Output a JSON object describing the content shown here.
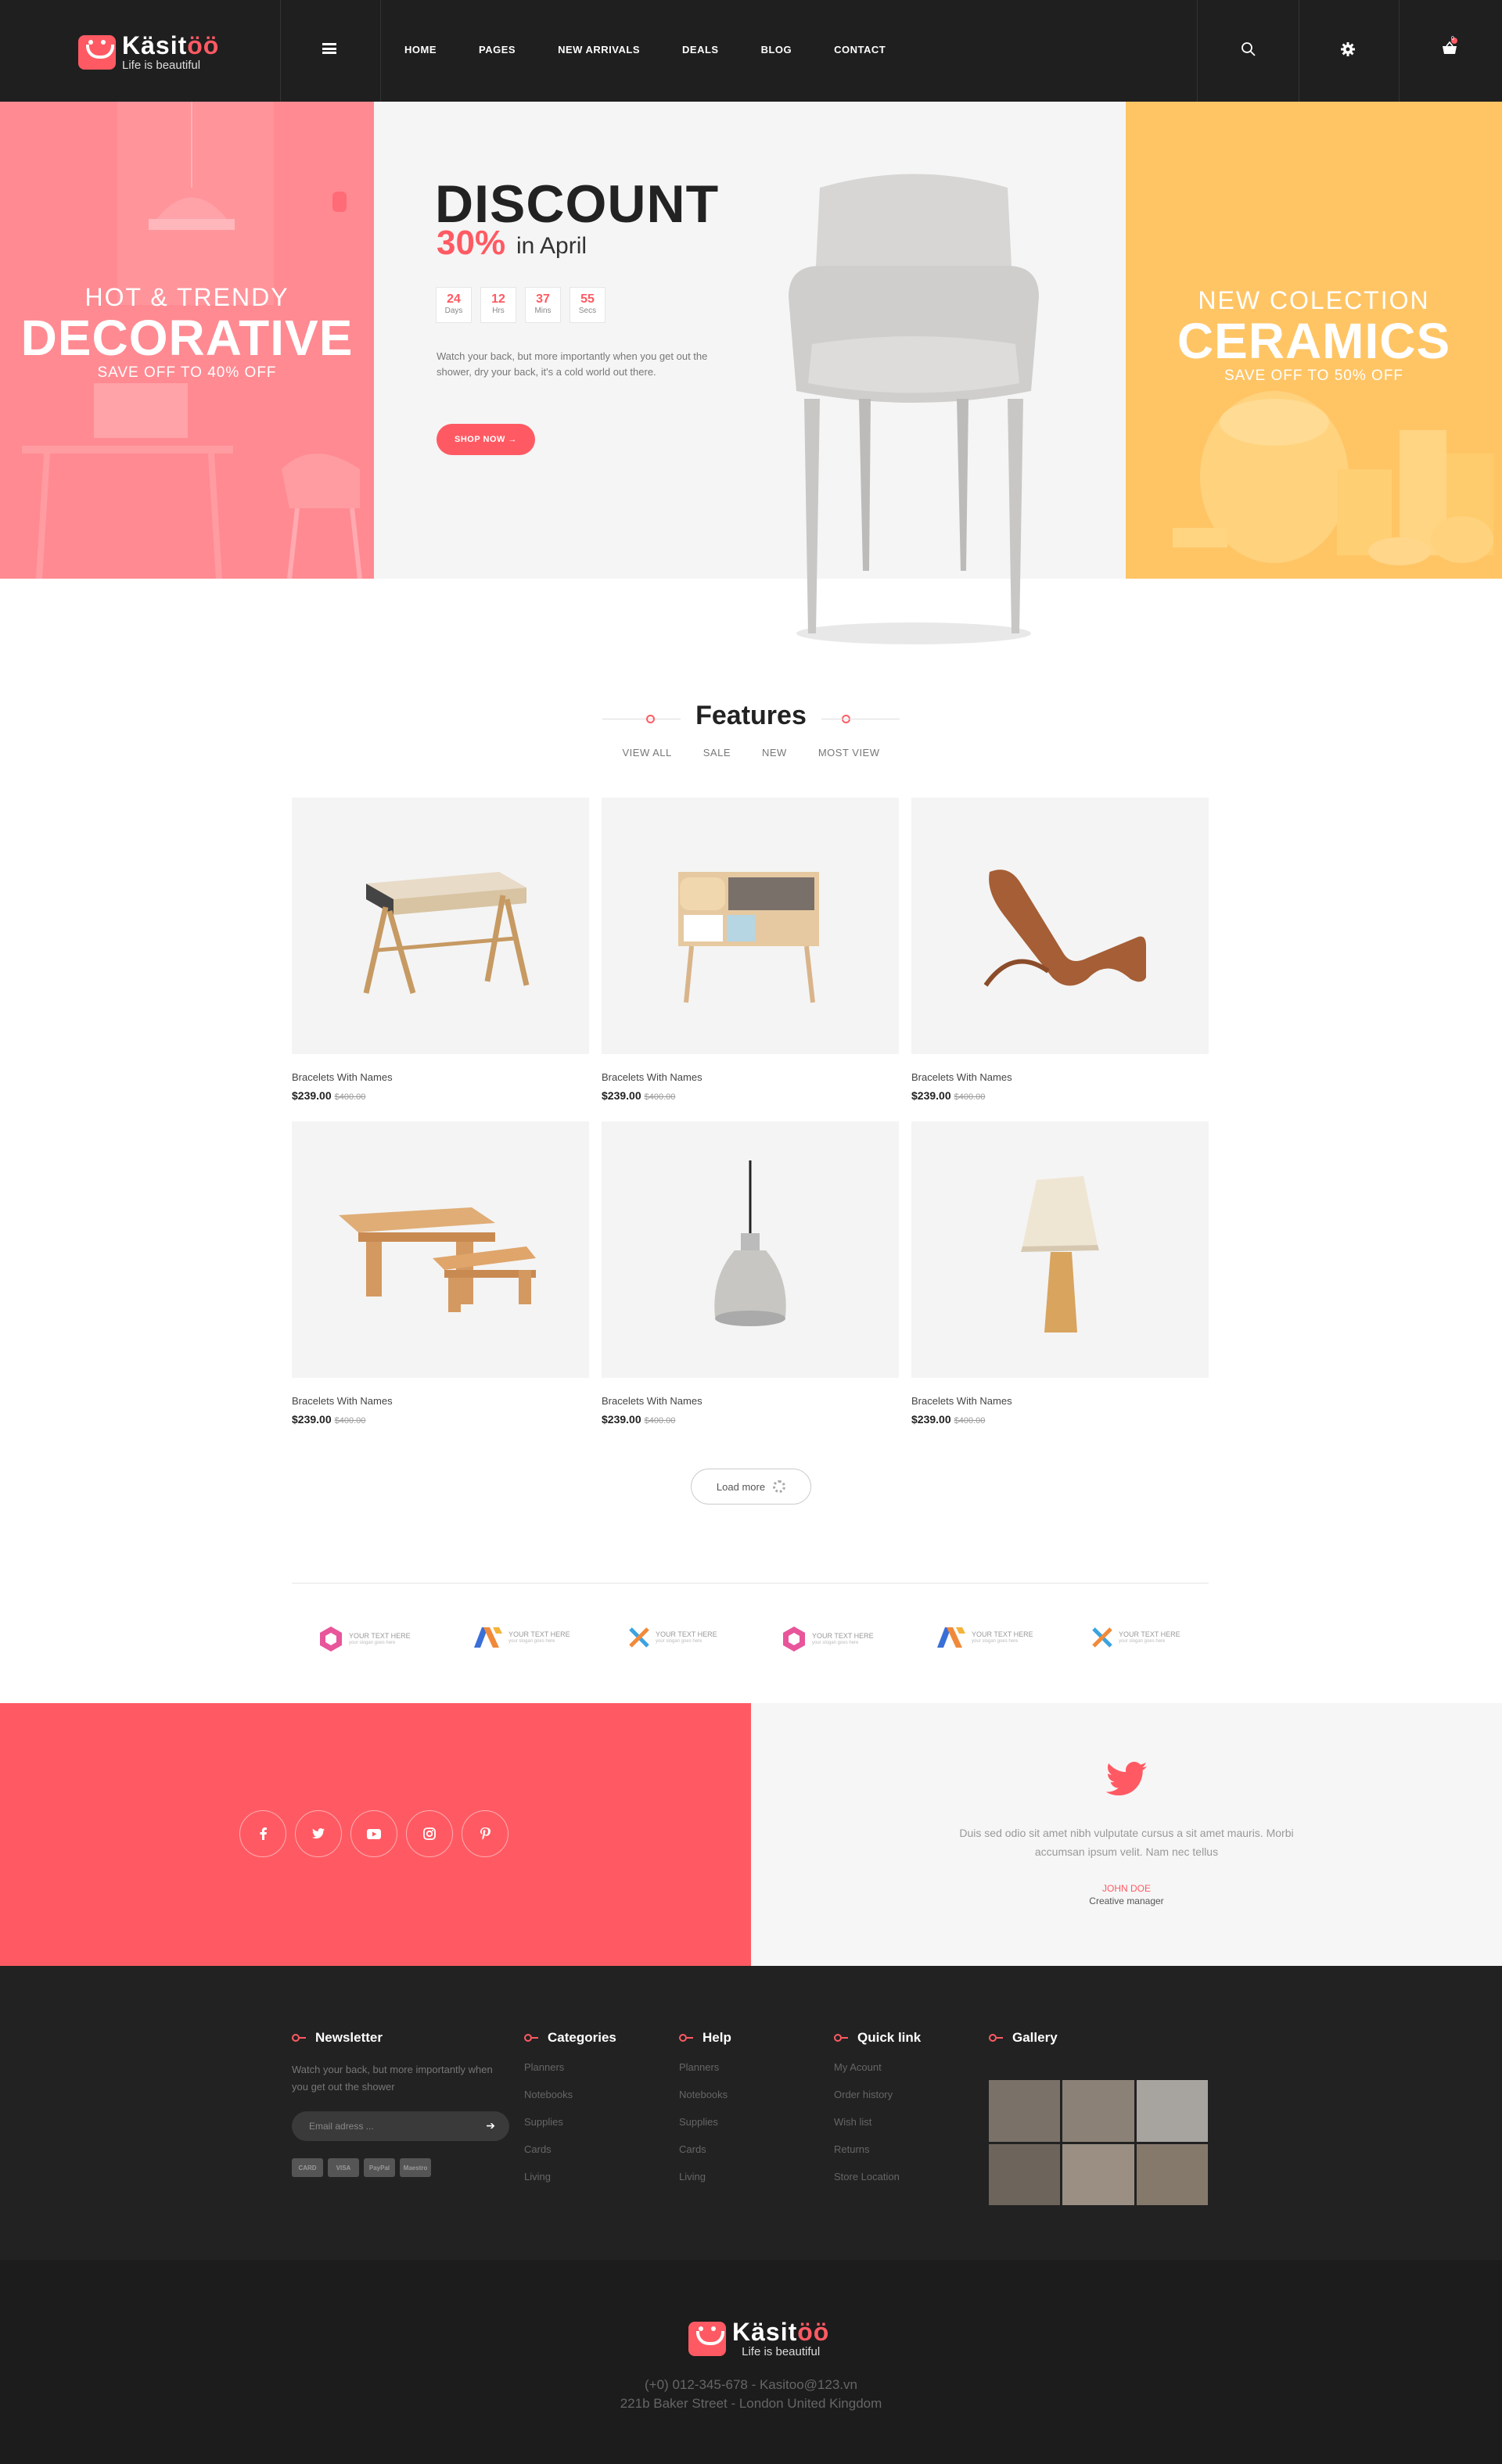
{
  "header": {
    "brand_name": "Kasitoo",
    "brand_name_display": "Käsitöö",
    "tagline": "Life is beautiful",
    "nav": [
      "HOME",
      "PAGES",
      "NEW ARRIVALS",
      "DEALS",
      "BLOG",
      "CONTACT"
    ],
    "cart_count": "0"
  },
  "hero": {
    "left": {
      "line1": "HOT & TRENDY",
      "line2": "DECORATIVE",
      "line3": "SAVE OFF TO 40% OFF"
    },
    "center": {
      "title": "DISCOUNT",
      "percent": "30%",
      "month": "in April",
      "countdown": [
        {
          "value": "24",
          "label": "Days"
        },
        {
          "value": "12",
          "label": "Hrs"
        },
        {
          "value": "37",
          "label": "Mins"
        },
        {
          "value": "55",
          "label": "Secs"
        }
      ],
      "description": "Watch your back, but more importantly when you get out the shower, dry your back, it's a cold world out there.",
      "button": "SHOP NOW →"
    },
    "right": {
      "line1": "NEW COLECTION",
      "line2": "CERAMICS",
      "line3": "SAVE OFF TO 50% OFF"
    }
  },
  "features": {
    "title": "Features",
    "tabs": [
      "VIEW ALL",
      "SALE",
      "NEW",
      "MOST VIEW"
    ],
    "products": [
      {
        "name": "Bracelets With Names",
        "price": "$239.00",
        "old_price": "$400.00",
        "image": "desk-table"
      },
      {
        "name": "Bracelets With Names",
        "price": "$239.00",
        "old_price": "$400.00",
        "image": "drawer-cabinet"
      },
      {
        "name": "Bracelets With Names",
        "price": "$239.00",
        "old_price": "$400.00",
        "image": "lounge-chair"
      },
      {
        "name": "Bracelets With Names",
        "price": "$239.00",
        "old_price": "$400.00",
        "image": "wooden-table-bench"
      },
      {
        "name": "Bracelets With Names",
        "price": "$239.00",
        "old_price": "$400.00",
        "image": "pendant-lamp"
      },
      {
        "name": "Bracelets With Names",
        "price": "$239.00",
        "old_price": "$400.00",
        "image": "table-lamp"
      }
    ],
    "load_more": "Load more"
  },
  "brands": [
    {
      "text": "YOUR TEXT HERE",
      "sub": "your slogan goes here",
      "color": "#e8559a"
    },
    {
      "text": "YOUR TEXT HERE",
      "sub": "your slogan goes here",
      "color": "#f08a3a"
    },
    {
      "text": "YOUR TEXT HERE",
      "sub": "your slogan goes here",
      "color": "#3aa3e0"
    },
    {
      "text": "YOUR TEXT HERE",
      "sub": "your slogan goes here",
      "color": "#e8559a"
    },
    {
      "text": "YOUR TEXT HERE",
      "sub": "your slogan goes here",
      "color": "#f08a3a"
    },
    {
      "text": "YOUR TEXT HERE",
      "sub": "your slogan goes here",
      "color": "#3aa3e0"
    }
  ],
  "social": {
    "icons": [
      "facebook-icon",
      "twitter-icon",
      "youtube-icon",
      "instagram-icon",
      "pinterest-icon"
    ]
  },
  "testimonial": {
    "quote": "Duis sed odio sit amet nibh vulputate cursus a sit amet mauris. Morbi accumsan ipsum velit. Nam nec tellus",
    "name": "JOHN DOE",
    "role": "Creative manager"
  },
  "footer": {
    "newsletter": {
      "title": "Newsletter",
      "description": "Watch your back, but more importantly when you get out the shower",
      "placeholder": "Email adress ...",
      "payments": [
        "CARD",
        "VISA",
        "PayPal",
        "Maestro"
      ]
    },
    "categories": {
      "title": "Categories",
      "links": [
        "Planners",
        "Notebooks",
        "Supplies",
        "Cards",
        "Living"
      ]
    },
    "help": {
      "title": "Help",
      "links": [
        "Planners",
        "Notebooks",
        "Supplies",
        "Cards",
        "Living"
      ]
    },
    "quicklink": {
      "title": "Quick link",
      "links": [
        "My Acount",
        "Order history",
        "Wish list",
        "Returns",
        "Store Location"
      ]
    },
    "gallery": {
      "title": "Gallery"
    }
  },
  "bottom": {
    "contact": "(+0) 012-345-678  -  Kasitoo@123.vn",
    "address": "221b Baker Street - London United Kingdom"
  },
  "colors": {
    "accent": "#ff5a63",
    "dark": "#1f1f1f",
    "peach": "#ffc060",
    "pink": "#ff7f88"
  }
}
